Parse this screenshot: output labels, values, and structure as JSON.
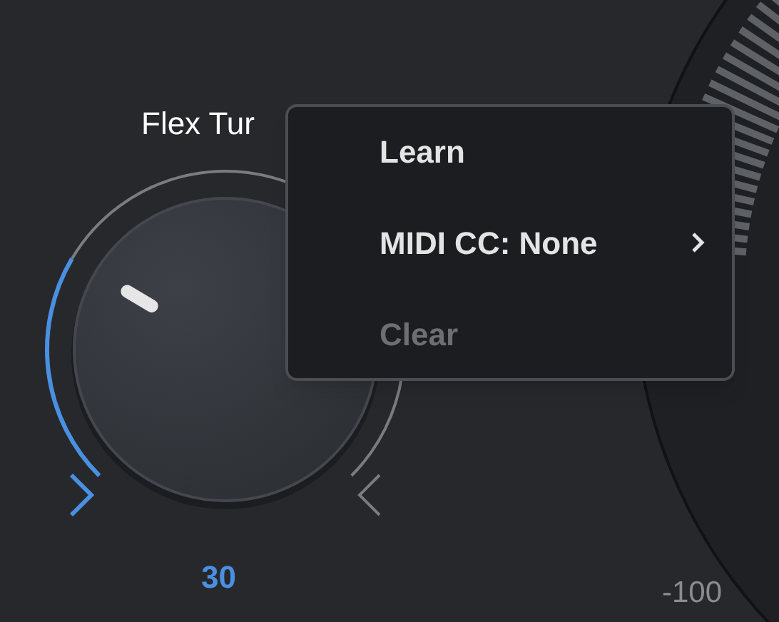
{
  "knob": {
    "label": "Flex Tur",
    "value": "30"
  },
  "dial": {
    "reading": "-100"
  },
  "context_menu": {
    "items": [
      {
        "label": "Learn",
        "kind": "item",
        "disabled": false
      },
      {
        "label": "MIDI CC: None",
        "kind": "submenu",
        "disabled": false
      },
      {
        "label": "Clear",
        "kind": "item",
        "disabled": true
      }
    ]
  }
}
